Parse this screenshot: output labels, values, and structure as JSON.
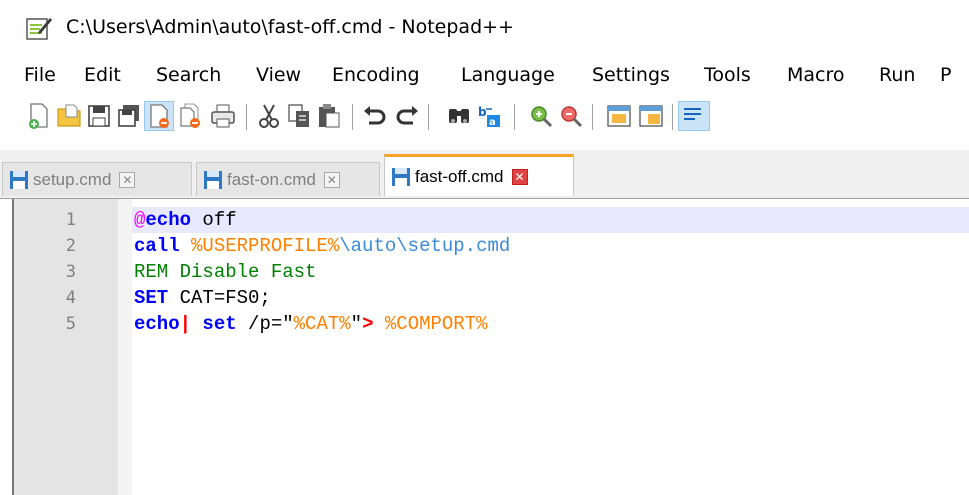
{
  "window": {
    "title": "C:\\Users\\Admin\\auto\\fast-off.cmd - Notepad++"
  },
  "menu": [
    "File",
    "Edit",
    "Search",
    "View",
    "Encoding",
    "Language",
    "Settings",
    "Tools",
    "Macro",
    "Run",
    "P"
  ],
  "toolbar_icons": [
    "new-file-icon",
    "open-file-icon",
    "save-icon",
    "save-all-icon",
    "close-icon",
    "close-all-icon",
    "print-icon",
    "cut-icon",
    "copy-icon",
    "paste-icon",
    "undo-icon",
    "redo-icon",
    "find-icon",
    "replace-icon",
    "zoom-in-icon",
    "zoom-out-icon",
    "sync-vertical-icon",
    "sync-horizontal-icon",
    "word-wrap-icon"
  ],
  "tabs": [
    {
      "label": "setup.cmd",
      "active": false
    },
    {
      "label": "fast-on.cmd",
      "active": false
    },
    {
      "label": "fast-off.cmd",
      "active": true
    }
  ],
  "editor": {
    "line_numbers": [
      "1",
      "2",
      "3",
      "4",
      "5"
    ],
    "lines": [
      {
        "tokens": [
          {
            "t": "@",
            "c": "at"
          },
          {
            "t": "echo",
            "c": "kw"
          },
          {
            "t": " off",
            "c": "txt"
          }
        ]
      },
      {
        "tokens": [
          {
            "t": "call",
            "c": "kw"
          },
          {
            "t": " ",
            "c": "txt"
          },
          {
            "t": "%USERPROFILE%",
            "c": "var"
          },
          {
            "t": "\\auto\\setup.cmd",
            "c": "path"
          }
        ]
      },
      {
        "tokens": [
          {
            "t": "REM Disable Fast",
            "c": "rem"
          }
        ]
      },
      {
        "tokens": [
          {
            "t": "SET",
            "c": "kw"
          },
          {
            "t": " CAT=FS0;",
            "c": "txt"
          }
        ]
      },
      {
        "tokens": [
          {
            "t": "echo",
            "c": "kw"
          },
          {
            "t": "|",
            "c": "op"
          },
          {
            "t": " ",
            "c": "txt"
          },
          {
            "t": "set",
            "c": "kw"
          },
          {
            "t": " /p=\"",
            "c": "txt"
          },
          {
            "t": "%CAT%",
            "c": "var"
          },
          {
            "t": "\"",
            "c": "txt"
          },
          {
            "t": ">",
            "c": "op"
          },
          {
            "t": " ",
            "c": "txt"
          },
          {
            "t": "%COMPORT%",
            "c": "var"
          }
        ]
      }
    ]
  },
  "colors": {
    "keyword": "#0000ff",
    "variable": "#ff8000",
    "comment": "#008000",
    "active_tab_accent": "#f7a32a",
    "current_line": "#e8e8ff"
  }
}
